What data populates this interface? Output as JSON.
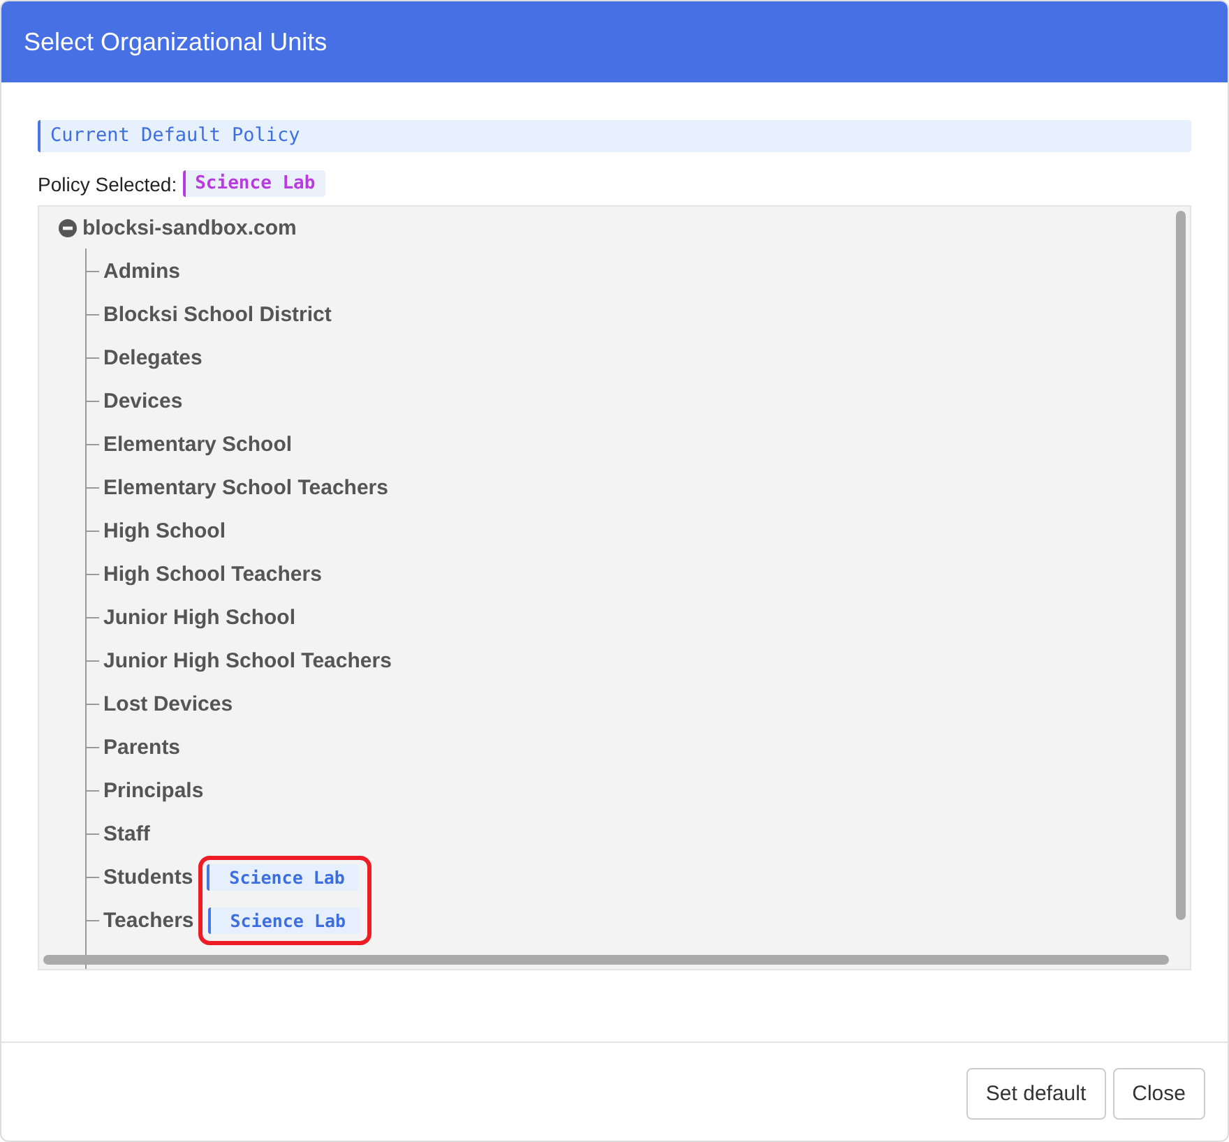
{
  "window": {
    "title": "Select Organizational Units"
  },
  "default_policy": {
    "label": "Current Default Policy"
  },
  "policy_selected": {
    "label": "Policy Selected:",
    "value": "Science Lab"
  },
  "tree": {
    "root": {
      "label": "blocksi-sandbox.com",
      "expanded": true,
      "children": [
        {
          "label": "Admins"
        },
        {
          "label": "Blocksi School District"
        },
        {
          "label": "Delegates"
        },
        {
          "label": "Devices"
        },
        {
          "label": "Elementary School"
        },
        {
          "label": "Elementary School Teachers"
        },
        {
          "label": "High School"
        },
        {
          "label": "High School Teachers"
        },
        {
          "label": "Junior High School"
        },
        {
          "label": "Junior High School Teachers"
        },
        {
          "label": "Lost Devices"
        },
        {
          "label": "Parents"
        },
        {
          "label": "Principals"
        },
        {
          "label": "Staff"
        },
        {
          "label": "Students",
          "policy": "Science Lab",
          "highlighted": true
        },
        {
          "label": "Teachers",
          "policy": "Science Lab",
          "highlighted": true
        }
      ]
    }
  },
  "buttons": [
    {
      "label": "Set default"
    },
    {
      "label": "Close"
    }
  ]
}
